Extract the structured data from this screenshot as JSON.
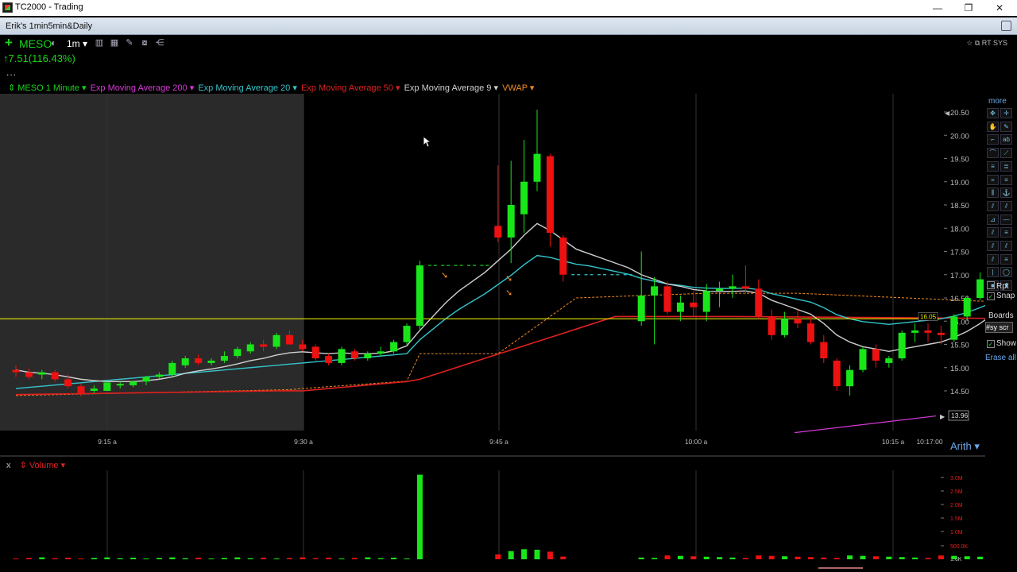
{
  "window": {
    "title": "TC2000 - Trading",
    "minimize": "—",
    "maximize": "❐",
    "close": "✕"
  },
  "tab": {
    "layout_name": "Erik's 1min5min&Daily"
  },
  "symbol_bar": {
    "symbol": "MESO",
    "timeframe": "1m ▾",
    "price_change": "↑7.51(116.43%)",
    "more": "...",
    "top_right": "☆ ⧉ RT SYS"
  },
  "legend": [
    {
      "label": "⇕ MESO 1 Minute ▾",
      "color": "#19d419"
    },
    {
      "label": "Exp Moving Average 200 ▾",
      "color": "#d63ad6"
    },
    {
      "label": "Exp Moving Average 20 ▾",
      "color": "#34c4cc"
    },
    {
      "label": "Exp Moving Average 50 ▾",
      "color": "#e02020"
    },
    {
      "label": "Exp Moving Average 9 ▾",
      "color": "#cfcfcf"
    },
    {
      "label": "VWAP ▾",
      "color": "#f08a24"
    }
  ],
  "toolbar": {
    "more": "more",
    "rpt": "Rpt",
    "snap": "Snap",
    "boards": "Boards",
    "boards_input": "#sy scr",
    "show": "Show",
    "erase_all": "Erase all",
    "arith": "Arith ▾"
  },
  "volume": {
    "close": "x",
    "label": "⇕ Volume ▾",
    "y_ticks": [
      "3.0M",
      "2.5M",
      "2.0M",
      "1.5M",
      "1.0M",
      "500.0K",
      "1.6K"
    ]
  },
  "colors": {
    "up": "#19e619",
    "down": "#ee1111",
    "ema200": "#d63ad6",
    "ema20": "#34c4cc",
    "ema50": "#e02020",
    "ema9": "#cfcfcf",
    "vwap": "#f08a24",
    "hline": "#e6e600",
    "premarket_bg": "#2a2a2a"
  },
  "chart_data": {
    "type": "candlestick",
    "symbol": "MESO",
    "interval": "1 Minute",
    "y_ticks": [
      "20.50",
      "20.00",
      "19.50",
      "19.00",
      "18.50",
      "18.00",
      "17.50",
      "17.00",
      "16.50",
      "16.00",
      "15.50",
      "15.00",
      "14.50"
    ],
    "x_ticks": [
      "9:15 a",
      "9:30 a",
      "9:45 a",
      "10:00 a",
      "10:15 a",
      "10:17:00"
    ],
    "ylim": [
      13.8,
      20.65
    ],
    "last_price_label": "16.05",
    "price_marker_label": "13.96",
    "horizontal_line": 16.05,
    "candles": [
      {
        "o": 14.95,
        "h": 15.05,
        "l": 14.8,
        "c": 14.9
      },
      {
        "o": 14.9,
        "h": 14.98,
        "l": 14.75,
        "c": 14.8
      },
      {
        "o": 14.85,
        "h": 14.95,
        "l": 14.75,
        "c": 14.9
      },
      {
        "o": 14.9,
        "h": 14.95,
        "l": 14.7,
        "c": 14.75
      },
      {
        "o": 14.75,
        "h": 14.85,
        "l": 14.55,
        "c": 14.6
      },
      {
        "o": 14.6,
        "h": 14.65,
        "l": 14.38,
        "c": 14.45
      },
      {
        "o": 14.5,
        "h": 14.62,
        "l": 14.45,
        "c": 14.55
      },
      {
        "o": 14.5,
        "h": 14.72,
        "l": 14.5,
        "c": 14.68
      },
      {
        "o": 14.62,
        "h": 14.7,
        "l": 14.55,
        "c": 14.65
      },
      {
        "o": 14.62,
        "h": 14.72,
        "l": 14.58,
        "c": 14.7
      },
      {
        "o": 14.7,
        "h": 14.82,
        "l": 14.62,
        "c": 14.8
      },
      {
        "o": 14.8,
        "h": 14.9,
        "l": 14.75,
        "c": 14.85
      },
      {
        "o": 14.85,
        "h": 15.15,
        "l": 14.8,
        "c": 15.1
      },
      {
        "o": 15.05,
        "h": 15.25,
        "l": 15.0,
        "c": 15.2
      },
      {
        "o": 15.2,
        "h": 15.28,
        "l": 15.05,
        "c": 15.1
      },
      {
        "o": 15.1,
        "h": 15.2,
        "l": 15.05,
        "c": 15.15
      },
      {
        "o": 15.15,
        "h": 15.35,
        "l": 15.1,
        "c": 15.25
      },
      {
        "o": 15.25,
        "h": 15.45,
        "l": 15.2,
        "c": 15.4
      },
      {
        "o": 15.35,
        "h": 15.55,
        "l": 15.3,
        "c": 15.5
      },
      {
        "o": 15.5,
        "h": 15.6,
        "l": 15.35,
        "c": 15.45
      },
      {
        "o": 15.45,
        "h": 15.75,
        "l": 15.4,
        "c": 15.7
      },
      {
        "o": 15.7,
        "h": 15.8,
        "l": 15.5,
        "c": 15.5
      },
      {
        "o": 15.5,
        "h": 15.6,
        "l": 15.35,
        "c": 15.4
      },
      {
        "o": 15.45,
        "h": 15.5,
        "l": 15.15,
        "c": 15.2
      },
      {
        "o": 15.25,
        "h": 15.3,
        "l": 15.05,
        "c": 15.1
      },
      {
        "o": 15.1,
        "h": 15.45,
        "l": 15.05,
        "c": 15.4
      },
      {
        "o": 15.35,
        "h": 15.4,
        "l": 15.15,
        "c": 15.2
      },
      {
        "o": 15.2,
        "h": 15.35,
        "l": 15.15,
        "c": 15.3
      },
      {
        "o": 15.3,
        "h": 15.45,
        "l": 15.25,
        "c": 15.35
      },
      {
        "o": 15.35,
        "h": 15.6,
        "l": 15.3,
        "c": 15.55
      },
      {
        "o": 15.55,
        "h": 15.95,
        "l": 15.5,
        "c": 15.9
      },
      {
        "o": 15.9,
        "h": 17.3,
        "l": 15.8,
        "c": 17.2
      },
      {
        "o": 17.2,
        "h": 17.2,
        "l": 17.2,
        "c": 17.2
      },
      {
        "o": 17.2,
        "h": 17.2,
        "l": 17.2,
        "c": 17.2
      },
      {
        "o": 17.2,
        "h": 17.2,
        "l": 17.2,
        "c": 17.2
      },
      {
        "o": 17.2,
        "h": 17.2,
        "l": 17.2,
        "c": 17.2
      },
      {
        "o": 17.2,
        "h": 17.2,
        "l": 17.2,
        "c": 17.2
      },
      {
        "o": 18.05,
        "h": 19.35,
        "l": 17.7,
        "c": 17.8
      },
      {
        "o": 17.8,
        "h": 19.45,
        "l": 17.25,
        "c": 18.5
      },
      {
        "o": 18.3,
        "h": 19.9,
        "l": 17.9,
        "c": 19.0
      },
      {
        "o": 19.0,
        "h": 20.55,
        "l": 18.8,
        "c": 19.6
      },
      {
        "o": 19.55,
        "h": 19.6,
        "l": 17.6,
        "c": 17.9
      },
      {
        "o": 17.8,
        "h": 17.85,
        "l": 16.85,
        "c": 17.0
      },
      {
        "o": 17.0,
        "h": 17.0,
        "l": 17.0,
        "c": 17.0
      },
      {
        "o": 17.0,
        "h": 17.0,
        "l": 17.0,
        "c": 17.0
      },
      {
        "o": 17.0,
        "h": 17.0,
        "l": 17.0,
        "c": 17.0
      },
      {
        "o": 17.0,
        "h": 17.0,
        "l": 17.0,
        "c": 17.0
      },
      {
        "o": 17.0,
        "h": 17.0,
        "l": 17.0,
        "c": 17.0
      },
      {
        "o": 16.0,
        "h": 17.5,
        "l": 15.9,
        "c": 16.55
      },
      {
        "o": 16.55,
        "h": 16.95,
        "l": 15.5,
        "c": 16.75
      },
      {
        "o": 16.75,
        "h": 16.85,
        "l": 16.15,
        "c": 16.2
      },
      {
        "o": 16.2,
        "h": 16.55,
        "l": 16.0,
        "c": 16.4
      },
      {
        "o": 16.4,
        "h": 16.65,
        "l": 16.1,
        "c": 16.3
      },
      {
        "o": 16.2,
        "h": 16.8,
        "l": 16.0,
        "c": 16.65
      },
      {
        "o": 16.65,
        "h": 16.85,
        "l": 16.3,
        "c": 16.7
      },
      {
        "o": 16.7,
        "h": 17.0,
        "l": 16.5,
        "c": 16.75
      },
      {
        "o": 16.75,
        "h": 17.2,
        "l": 16.6,
        "c": 16.7
      },
      {
        "o": 16.7,
        "h": 16.9,
        "l": 16.05,
        "c": 16.1
      },
      {
        "o": 16.1,
        "h": 16.25,
        "l": 15.6,
        "c": 15.7
      },
      {
        "o": 15.7,
        "h": 16.2,
        "l": 15.65,
        "c": 16.05
      },
      {
        "o": 16.05,
        "h": 16.25,
        "l": 15.85,
        "c": 15.95
      },
      {
        "o": 15.95,
        "h": 16.1,
        "l": 15.5,
        "c": 15.55
      },
      {
        "o": 15.55,
        "h": 15.7,
        "l": 15.1,
        "c": 15.2
      },
      {
        "o": 15.15,
        "h": 15.2,
        "l": 14.5,
        "c": 14.6
      },
      {
        "o": 14.6,
        "h": 15.05,
        "l": 14.4,
        "c": 14.95
      },
      {
        "o": 14.95,
        "h": 15.45,
        "l": 14.9,
        "c": 15.4
      },
      {
        "o": 15.4,
        "h": 15.5,
        "l": 15.0,
        "c": 15.15
      },
      {
        "o": 15.1,
        "h": 15.25,
        "l": 15.0,
        "c": 15.2
      },
      {
        "o": 15.2,
        "h": 15.8,
        "l": 15.15,
        "c": 15.75
      },
      {
        "o": 15.75,
        "h": 15.95,
        "l": 15.55,
        "c": 15.8
      },
      {
        "o": 15.8,
        "h": 15.95,
        "l": 15.55,
        "c": 15.75
      },
      {
        "o": 15.75,
        "h": 15.9,
        "l": 15.5,
        "c": 15.7
      },
      {
        "o": 15.6,
        "h": 16.15,
        "l": 15.55,
        "c": 16.1
      },
      {
        "o": 16.1,
        "h": 16.55,
        "l": 16.0,
        "c": 16.5
      },
      {
        "o": 16.5,
        "h": 17.05,
        "l": 16.45,
        "c": 16.9
      },
      {
        "o": 16.9,
        "h": 17.2,
        "l": 16.7,
        "c": 17.0
      },
      {
        "o": 17.0,
        "h": 17.05,
        "l": 16.85,
        "c": 16.95
      },
      {
        "o": 16.95,
        "h": 17.05,
        "l": 16.5,
        "c": 16.6
      },
      {
        "o": 16.8,
        "h": 17.05,
        "l": 16.6,
        "c": 17.0
      },
      {
        "o": 17.0,
        "h": 17.05,
        "l": 16.3,
        "c": 16.35
      },
      {
        "o": 16.2,
        "h": 16.3,
        "l": 15.85,
        "c": 15.95
      },
      {
        "o": 15.95,
        "h": 16.15,
        "l": 15.9,
        "c": 16.1
      }
    ],
    "ema9": [
      14.95,
      14.9,
      14.88,
      14.85,
      14.8,
      14.75,
      14.72,
      14.7,
      14.7,
      14.7,
      14.72,
      14.75,
      14.8,
      14.88,
      14.93,
      14.97,
      15.02,
      15.08,
      15.15,
      15.2,
      15.27,
      15.32,
      15.34,
      15.32,
      15.3,
      15.32,
      15.3,
      15.3,
      15.31,
      15.36,
      15.47,
      15.8,
      16.1,
      16.4,
      16.65,
      16.85,
      17.05,
      17.3,
      17.55,
      17.85,
      18.1,
      17.95,
      17.75,
      17.55,
      17.45,
      17.35,
      17.25,
      17.15,
      17.0,
      16.9,
      16.8,
      16.75,
      16.68,
      16.65,
      16.64,
      16.64,
      16.65,
      16.6,
      16.45,
      16.35,
      16.25,
      16.15,
      15.95,
      15.7,
      15.55,
      15.45,
      15.4,
      15.35,
      15.4,
      15.45,
      15.5,
      15.55,
      15.65,
      15.78,
      15.95,
      16.15,
      16.3,
      16.4,
      16.5,
      16.55,
      16.45,
      16.35
    ]
  }
}
